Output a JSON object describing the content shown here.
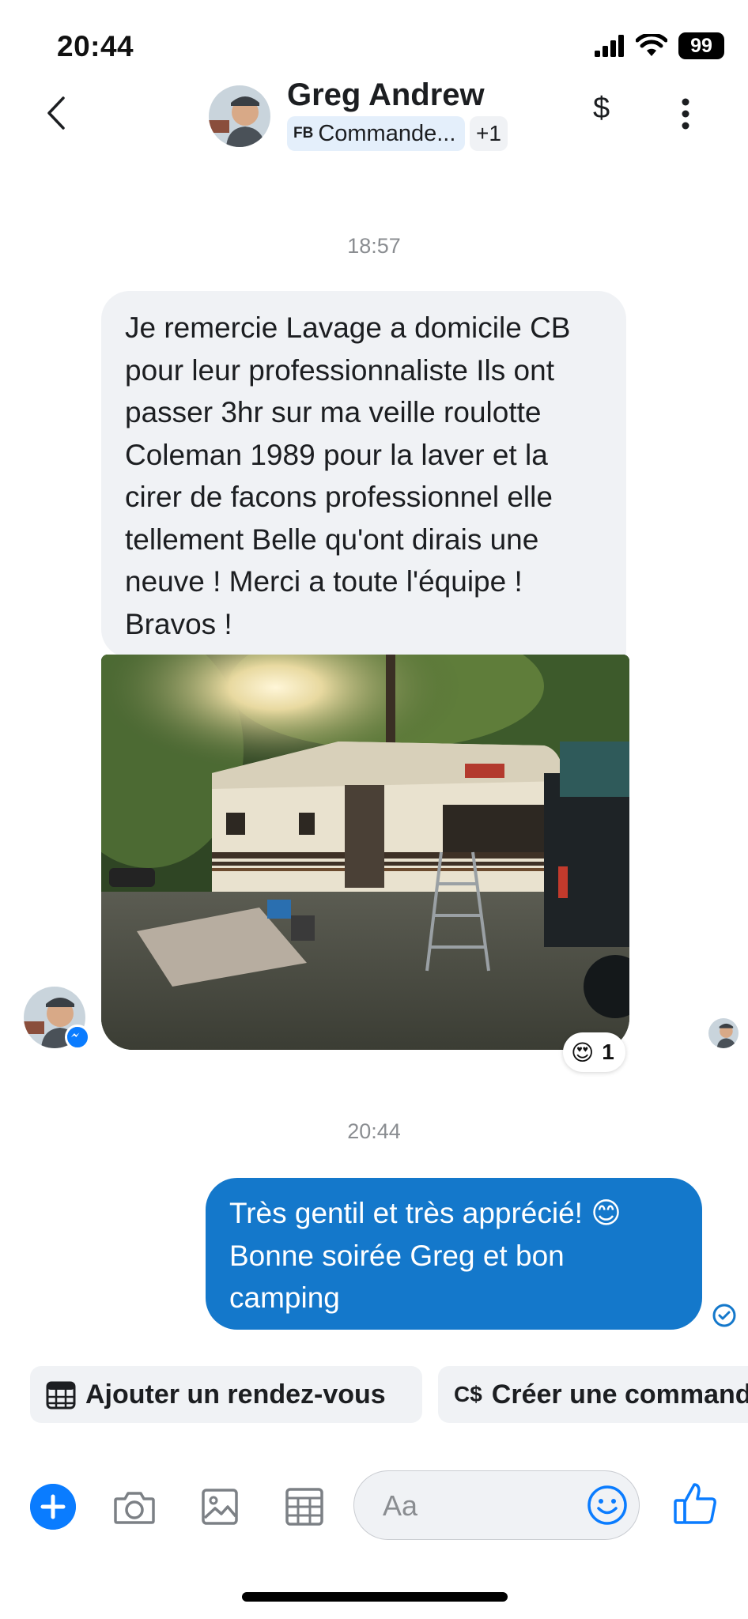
{
  "status_bar": {
    "time": "20:44",
    "battery": "99"
  },
  "header": {
    "contact_name": "Greg Andrew",
    "tag_prefix": "FB",
    "tag_label": "Commande...",
    "tag_extra": "+1",
    "payment_label": "$"
  },
  "messages": [
    {
      "timestamp": "18:57",
      "direction": "incoming",
      "text": "Je remercie Lavage a domicile CB pour leur professionnaliste Ils ont passer 3hr sur ma veille roulotte Coleman 1989  pour la laver et la cirer de facons professionnel elle tellement Belle qu'ont dirais une neuve ! Merci a toute l'équipe ! Bravos !",
      "photo": "photo of a Coleman travel trailer at a wooded campsite",
      "photo_brand_text": "Coleman",
      "reaction": {
        "emoji": "😍",
        "count": "1"
      }
    },
    {
      "timestamp": "20:44",
      "direction": "outgoing",
      "text": "Très gentil et très apprécié! 😊 Bonne soirée Greg et bon camping"
    }
  ],
  "quick_actions": [
    {
      "label": "Ajouter un rendez-vous",
      "icon": "calendar-icon"
    },
    {
      "prefix": "C$",
      "label": "Créer une commande",
      "icon": "currency-icon"
    }
  ],
  "composer": {
    "placeholder": "Aa",
    "tools": [
      "plus-icon",
      "camera-icon",
      "gallery-icon",
      "calendar-icon",
      "emoji-icon",
      "thumbs-up-icon"
    ]
  },
  "colors": {
    "accent": "#0a7cff",
    "outgoing_bubble": "#1478cb",
    "incoming_bubble": "#f0f2f5",
    "timestamp": "#8a8d91"
  }
}
